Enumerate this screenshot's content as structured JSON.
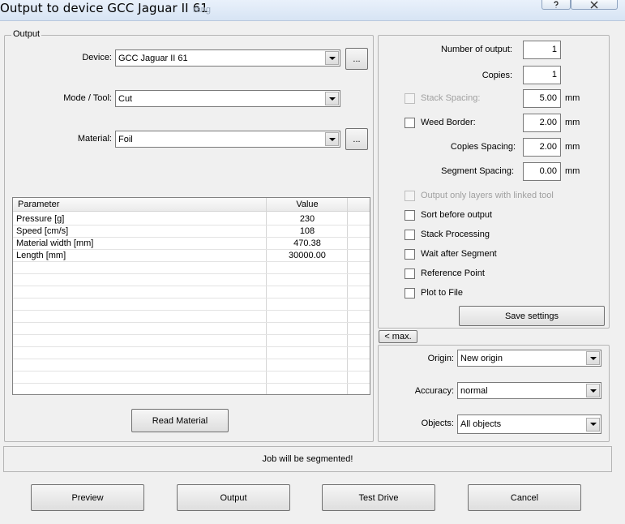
{
  "window": {
    "title": "Output to device GCC Jaguar II 61",
    "ghost_text": "rang"
  },
  "output_group": {
    "legend": "Output",
    "device_label": "Device:",
    "device_value": "GCC Jaguar II 61",
    "mode_label": "Mode / Tool:",
    "mode_value": "Cut",
    "material_label": "Material:",
    "material_value": "Foil",
    "browse_label": "..."
  },
  "params_table": {
    "headers": [
      "Parameter",
      "Value"
    ],
    "rows": [
      {
        "param": "Pressure [g]",
        "value": "230"
      },
      {
        "param": "Speed [cm/s]",
        "value": "108"
      },
      {
        "param": "Material width [mm]",
        "value": "470.38"
      },
      {
        "param": "Length [mm]",
        "value": "30000.00"
      }
    ]
  },
  "read_material_label": "Read Material",
  "settings": {
    "number_of_output_label": "Number of output:",
    "number_of_output": "1",
    "copies_label": "Copies:",
    "copies": "1",
    "stack_spacing_label": "Stack Spacing:",
    "stack_spacing": "5.00",
    "weed_border_label": "Weed Border:",
    "weed_border": "2.00",
    "copies_spacing_label": "Copies Spacing:",
    "copies_spacing": "2.00",
    "segment_spacing_label": "Segment Spacing:",
    "segment_spacing": "0.00",
    "unit": "mm",
    "options": [
      {
        "label": "Output only layers with linked tool",
        "enabled": false
      },
      {
        "label": "Sort before output",
        "enabled": true
      },
      {
        "label": "Stack Processing",
        "enabled": true
      },
      {
        "label": "Wait after Segment",
        "enabled": true
      },
      {
        "label": "Reference Point",
        "enabled": true
      },
      {
        "label": "Plot to File",
        "enabled": true
      }
    ],
    "save_label": "Save settings"
  },
  "max_label": "< max.",
  "position": {
    "origin_label": "Origin:",
    "origin_value": "New origin",
    "accuracy_label": "Accuracy:",
    "accuracy_value": "normal",
    "objects_label": "Objects:",
    "objects_value": "All objects"
  },
  "status_text": "Job will be segmented!",
  "buttons": {
    "preview": "Preview",
    "output": "Output",
    "test_drive": "Test Drive",
    "cancel": "Cancel"
  }
}
